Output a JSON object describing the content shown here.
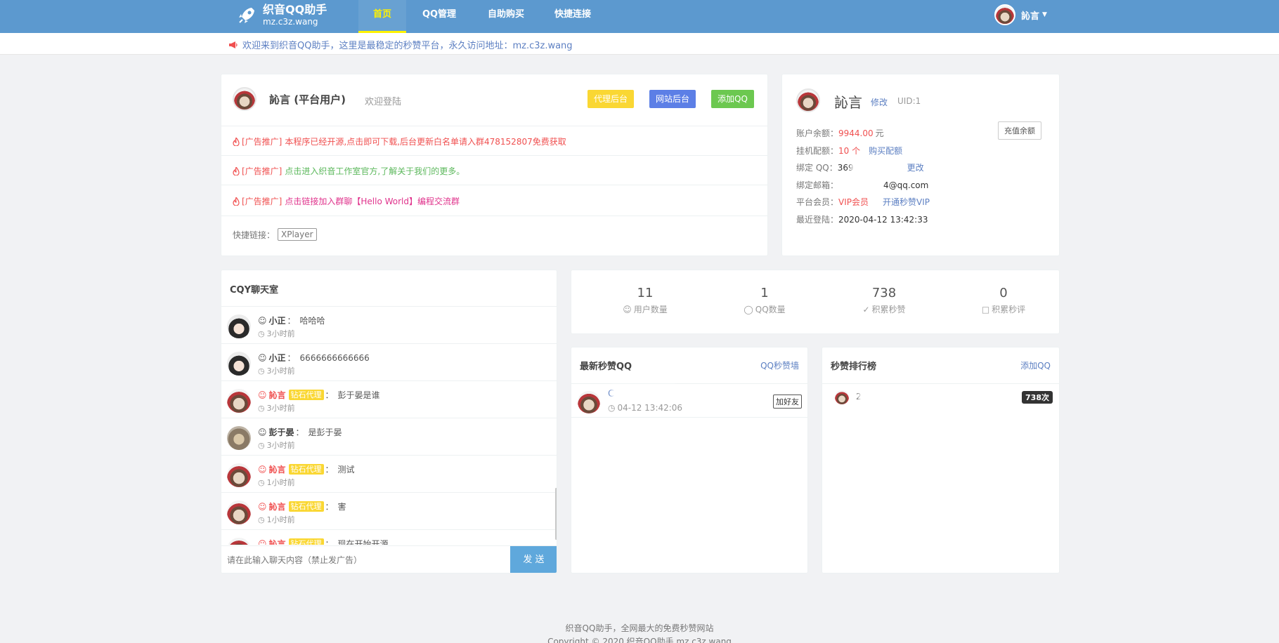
{
  "brand": {
    "title": "织音QQ助手",
    "domain": "mz.c3z.wang"
  },
  "nav": {
    "items": [
      {
        "label": "首页",
        "active": true
      },
      {
        "label": "QQ管理"
      },
      {
        "label": "自助购买"
      },
      {
        "label": "快捷连接"
      }
    ],
    "user": "訫言"
  },
  "notice": "欢迎来到织音QQ助手，这里是最稳定的秒赞平台，永久访问地址：mz.c3z.wang",
  "welcome": {
    "name": "訫言 (平台用户)",
    "greeting": "欢迎登陆",
    "buttons": [
      {
        "label": "代理后台",
        "color": "#fad733"
      },
      {
        "label": "网站后台",
        "color": "#5c7fe6"
      },
      {
        "label": "添加QQ",
        "color": "#6cc850"
      }
    ],
    "ads": [
      {
        "tag": "[广告推广]",
        "text": "本程序已经开源,点击即可下载,后台更新白名单请入群478152807免费获取",
        "color": "#f05050"
      },
      {
        "tag": "[广告推广]",
        "text": "点击进入织音工作室官方,了解关于我们的更多。",
        "color": "#5cb85c"
      },
      {
        "tag": "[广告推广]",
        "text": "点击链接加入群聊【Hello World】编程交流群",
        "color": "#e0338c"
      }
    ],
    "quick_label": "快捷链接：",
    "quick_links": [
      "XPlayer"
    ]
  },
  "account": {
    "name": "訫言",
    "edit": "修改",
    "uid": "UID:1",
    "recharge": "充值余额",
    "balance_label": "账户余额：",
    "balance": "9944.00",
    "balance_unit": "元",
    "quota_label": "挂机配额：",
    "quota": "10 个",
    "buy_quota": "购买配额",
    "qq_label": "绑定 QQ：",
    "qq_value": "369",
    "change": "更改",
    "email_label": "绑定邮箱：",
    "email_value": "4@qq.com",
    "member_label": "平台会员：",
    "member_value": "VIP会员",
    "open_vip": "开通秒赞VIP",
    "last_login_label": "最近登陆：",
    "last_login": "2020-04-12 13:42:33"
  },
  "chat": {
    "title": "CQY聊天室",
    "messages": [
      {
        "user": "小正",
        "sep": "：",
        "text": "哈哈哈",
        "time": "3小时前",
        "avatar": "girl"
      },
      {
        "user": "小正",
        "sep": "：",
        "text": "6666666666666",
        "time": "3小时前",
        "avatar": "girl"
      },
      {
        "user": "訫言",
        "badge": "钻石代理",
        "sep": "：",
        "text": "彭于晏是谁",
        "time": "3小时前",
        "avatar": "user"
      },
      {
        "user": "彭于晏",
        "sep": "：",
        "text": "是彭于晏",
        "time": "3小时前",
        "avatar": "cat"
      },
      {
        "user": "訫言",
        "badge": "钻石代理",
        "sep": "：",
        "text": "测试",
        "time": "1小时前",
        "avatar": "user"
      },
      {
        "user": "訫言",
        "badge": "钻石代理",
        "sep": "：",
        "text": "害",
        "time": "1小时前",
        "avatar": "user"
      },
      {
        "user": "訫言",
        "badge": "钻石代理",
        "sep": "：",
        "text": "现在开始开源",
        "time": "",
        "avatar": "user"
      }
    ],
    "placeholder": "请在此输入聊天内容（禁止发广告）",
    "send": "发 送"
  },
  "stats": [
    {
      "num": "11",
      "label": "用户数量",
      "icon": "user-icon"
    },
    {
      "num": "1",
      "label": "QQ数量",
      "icon": "qq-icon"
    },
    {
      "num": "738",
      "label": "积累秒赞",
      "icon": "thumb-up-icon"
    },
    {
      "num": "0",
      "label": "积累秒评",
      "icon": "comment-icon"
    }
  ],
  "latest": {
    "title": "最新秒赞QQ",
    "link": "QQ秒赞墙",
    "item": {
      "name": "C",
      "time": "04-12 13:42:06",
      "action": "加好友"
    }
  },
  "ranking": {
    "title": "秒赞排行榜",
    "link": "添加QQ",
    "item": {
      "name": "2",
      "count": "738次"
    }
  },
  "footer": {
    "line1": "织音QQ助手，全网最大的免费秒赞网站",
    "line2": "Copyright © 2020 织音QQ助手 mz.c3z.wang"
  },
  "colors": {
    "nav": "#5c99cf",
    "accent": "#fff200",
    "red": "#f05050",
    "link": "#5c7fc2"
  }
}
